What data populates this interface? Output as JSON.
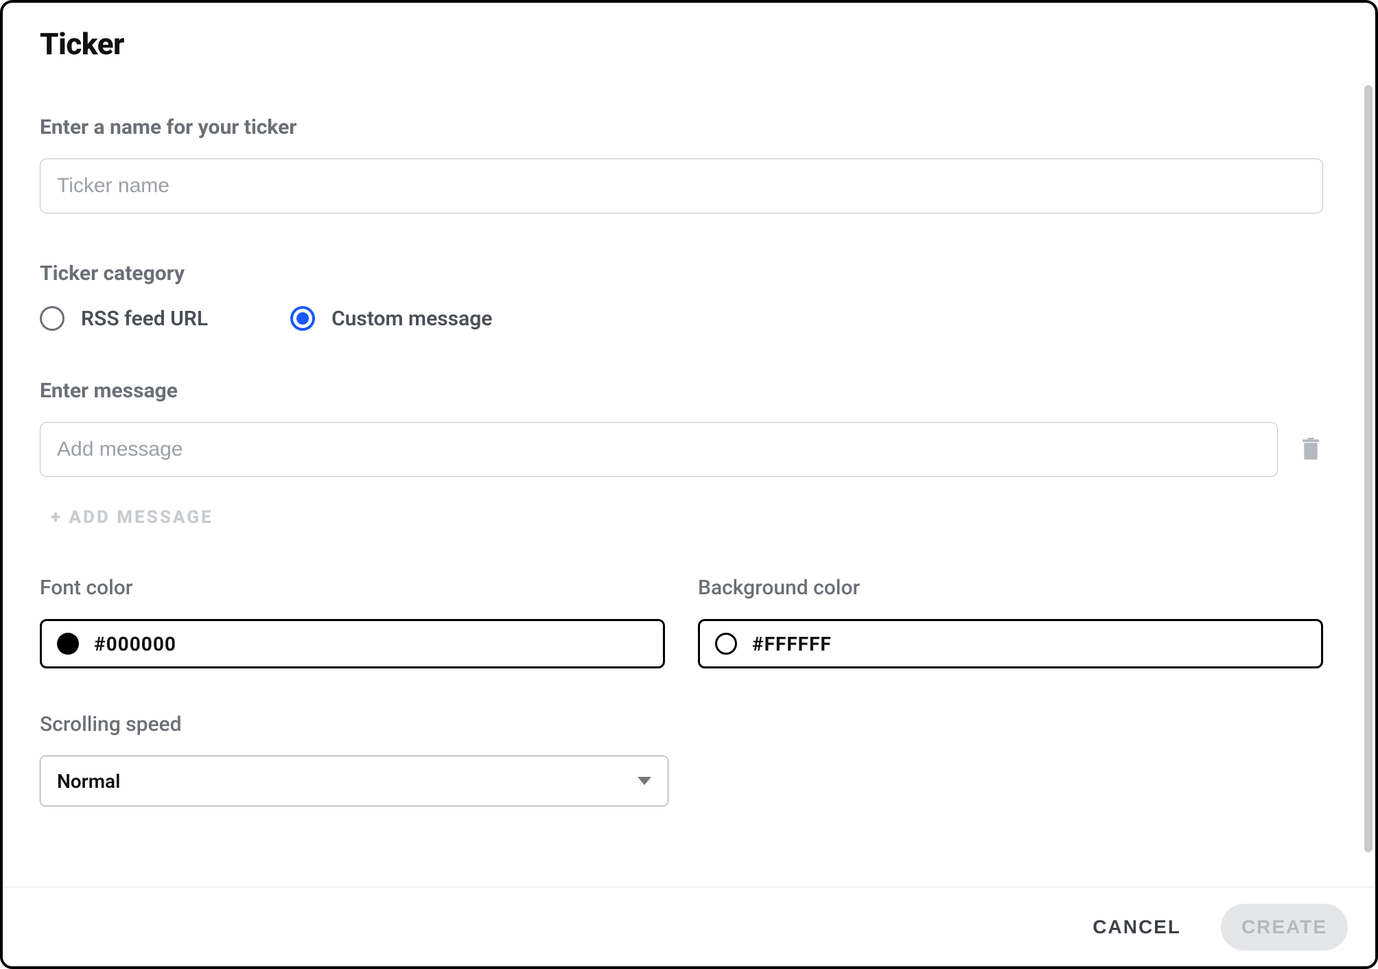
{
  "dialog": {
    "title": "Ticker",
    "name_field": {
      "label": "Enter a name for your ticker",
      "placeholder": "Ticker name",
      "value": ""
    },
    "category": {
      "label": "Ticker category",
      "options": {
        "rss": "RSS feed URL",
        "custom": "Custom message"
      },
      "selected": "custom"
    },
    "message_field": {
      "label": "Enter message",
      "placeholder": "Add message",
      "value": ""
    },
    "add_message_label": "+ ADD MESSAGE",
    "font_color": {
      "label": "Font color",
      "value": "#000000"
    },
    "background_color": {
      "label": "Background color",
      "value": "#FFFFFF"
    },
    "scrolling_speed": {
      "label": "Scrolling speed",
      "value": "Normal"
    },
    "footer": {
      "cancel": "CANCEL",
      "create": "CREATE"
    }
  }
}
